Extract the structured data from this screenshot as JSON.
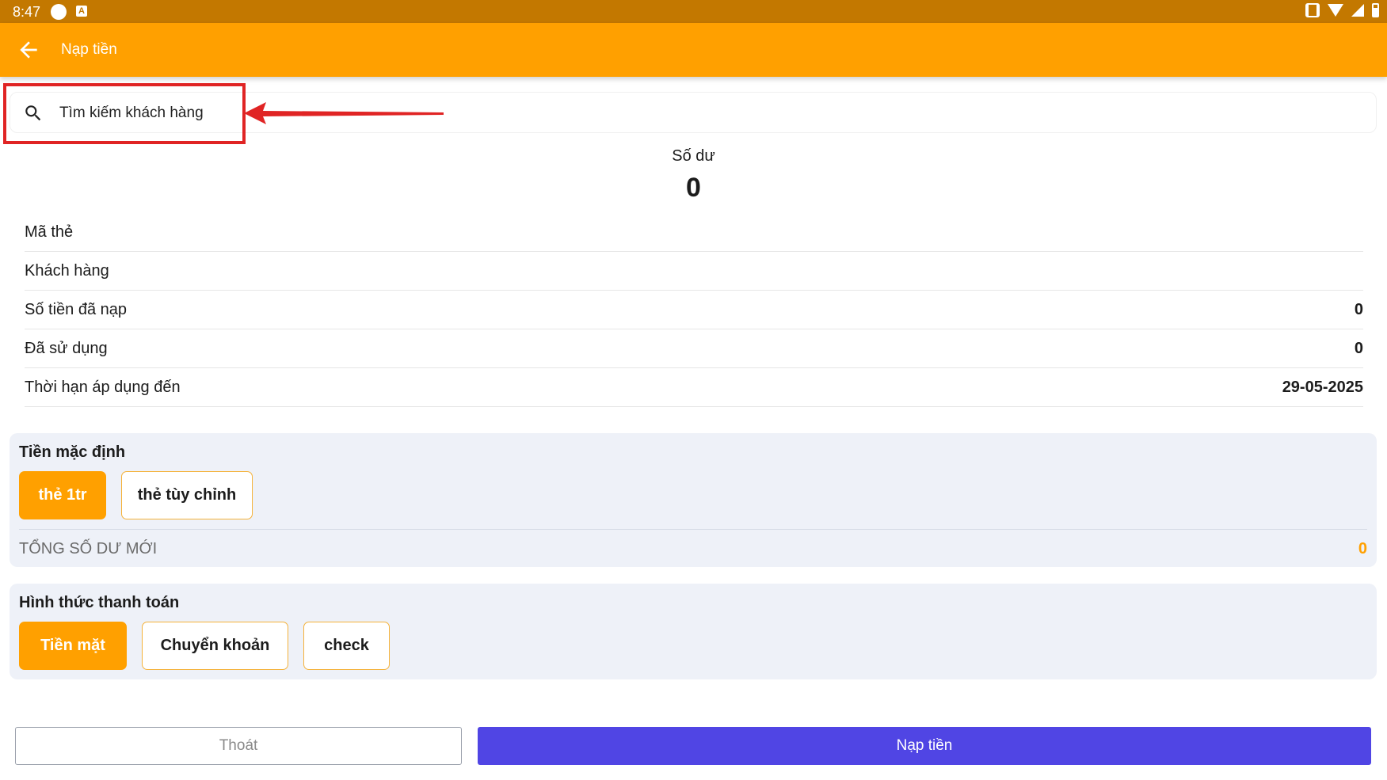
{
  "status_bar": {
    "time": "8:47",
    "notification_icon": "A"
  },
  "app_bar": {
    "title": "Nạp tiền",
    "back_icon": "arrow-left-icon"
  },
  "search": {
    "placeholder": "Tìm kiếm khách hàng",
    "icon": "search-icon"
  },
  "balance": {
    "label": "Số dư",
    "value": "0"
  },
  "info_rows": [
    {
      "label": "Mã thẻ",
      "value": ""
    },
    {
      "label": "Khách hàng",
      "value": ""
    },
    {
      "label": "Số tiền đã nạp",
      "value": "0"
    },
    {
      "label": "Đã sử dụng",
      "value": "0"
    },
    {
      "label": "Thời hạn áp dụng đến",
      "value": "29-05-2025"
    }
  ],
  "default_amount": {
    "title": "Tiền mặc định",
    "options": [
      {
        "label": "thẻ 1tr",
        "selected": true
      },
      {
        "label": "thẻ tùy chỉnh",
        "selected": false
      }
    ],
    "total_label": "TỔNG SỐ DƯ MỚI",
    "total_value": "0"
  },
  "payment_method": {
    "title": "Hình thức thanh toán",
    "options": [
      {
        "label": "Tiền mặt",
        "selected": true
      },
      {
        "label": "Chuyển khoản",
        "selected": false
      },
      {
        "label": "check",
        "selected": false
      }
    ]
  },
  "actions": {
    "exit_label": "Thoát",
    "topup_label": "Nạp tiền"
  },
  "colors": {
    "accent": "#ffa000",
    "status_bar": "#c37800",
    "primary_button": "#5045e4",
    "highlight": "#e02424"
  }
}
